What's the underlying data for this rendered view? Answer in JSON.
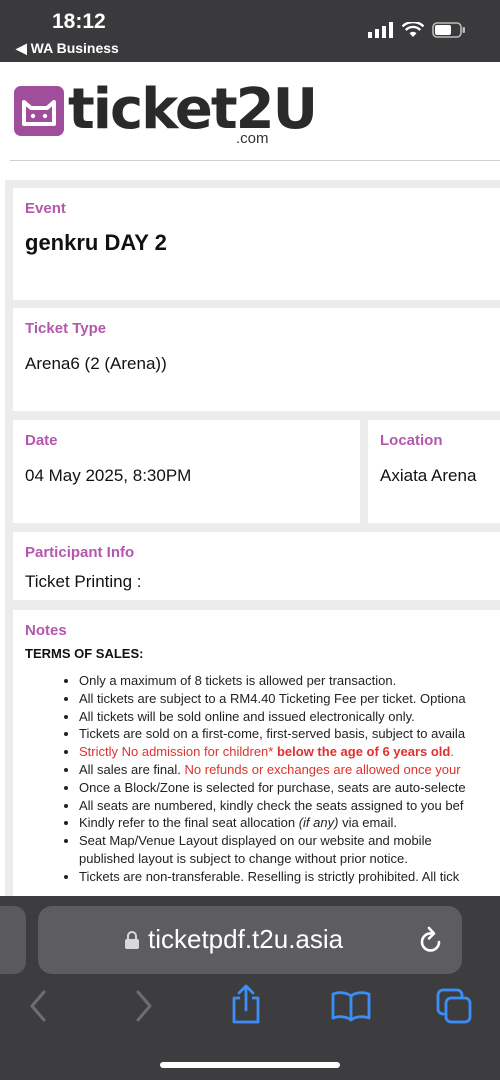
{
  "status_bar": {
    "time": "18:12",
    "back_app": "◀ WA Business"
  },
  "logo": {
    "word": "ticket2U",
    "suffix": ".com"
  },
  "event": {
    "label": "Event",
    "value": "genkru DAY 2"
  },
  "ticket_type": {
    "label": "Ticket Type",
    "value": "Arena6 (2 (Arena))"
  },
  "date": {
    "label": "Date",
    "value": "04 May 2025, 8:30PM"
  },
  "location": {
    "label": "Location",
    "value": "Axiata Arena"
  },
  "participant": {
    "label": "Participant Info",
    "value": "Ticket Printing :"
  },
  "notes": {
    "label": "Notes",
    "terms_heading": "TERMS OF SALES:",
    "items": [
      "Only a maximum of 8 tickets is allowed per transaction.",
      "All tickets are subject to a RM4.40 Ticketing Fee per ticket. Optiona",
      "All tickets will be sold online and issued electronically only.",
      "Tickets are sold on a first-come, first-served basis, subject to availa",
      "Strictly No admission for children*",
      "below the age of 6 years old",
      "All sales are final.",
      "No refunds or exchanges are allowed once your",
      "Once a Block/Zone is selected for purchase, seats are auto-selecte",
      "All seats are numbered, kindly check the seats assigned to you bef",
      "Kindly refer to the final seat allocation",
      "(if any)",
      "via email.",
      "Seat Map/Venue Layout displayed on our website and mobile",
      "published layout is subject to change without prior notice.",
      "Tickets are non-transferable. Reselling is strictly prohibited. All tick"
    ]
  },
  "browser": {
    "url": "ticketpdf.t2u.asia"
  },
  "colors": {
    "accent": "#b457ad",
    "warning": "#e0312c",
    "ios_blue": "#3a8ff7"
  }
}
